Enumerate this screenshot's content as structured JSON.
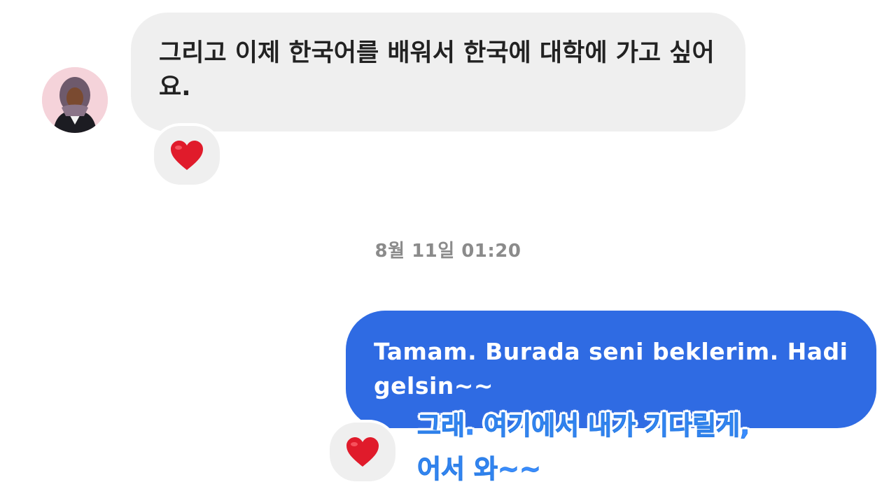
{
  "incoming": {
    "message": "그리고 이제 한국어를 배워서 한국에 대학에 가고 싶어요.",
    "reaction": "❤️"
  },
  "timestamp": "8월 11일 01:20",
  "outgoing": {
    "message": "Tamam. Burada seni beklerim. Hadi gelsin~~",
    "reaction": "❤️"
  },
  "subtitle": {
    "line1": "그래. 여기에서 내가 기다릴게,",
    "line2": "어서 와~~"
  },
  "colors": {
    "outgoing_bubble": "#2f6be3",
    "incoming_bubble": "#efefef",
    "heart": "#e01b2b",
    "subtitle_text": "#3a8dff"
  }
}
